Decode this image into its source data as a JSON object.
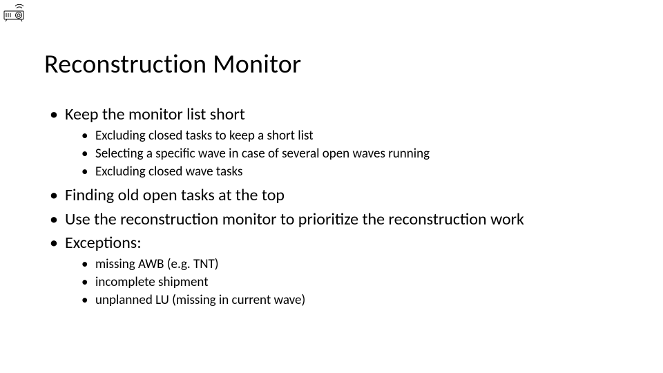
{
  "icon": {
    "name": "projector-icon"
  },
  "title": "Reconstruction Monitor",
  "bullets": [
    {
      "text": "Keep the monitor list short",
      "children": [
        "Excluding closed tasks to keep a short list",
        "Selecting a specific wave in case of several open waves running",
        "Excluding closed wave tasks"
      ]
    },
    {
      "text": "Finding old open tasks at the top",
      "children": []
    },
    {
      "text": "Use the reconstruction monitor to prioritize the reconstruction work",
      "children": []
    },
    {
      "text": "Exceptions:",
      "children": [
        "missing AWB (e.g. TNT)",
        "incomplete shipment",
        "unplanned LU (missing in current wave)"
      ]
    }
  ]
}
